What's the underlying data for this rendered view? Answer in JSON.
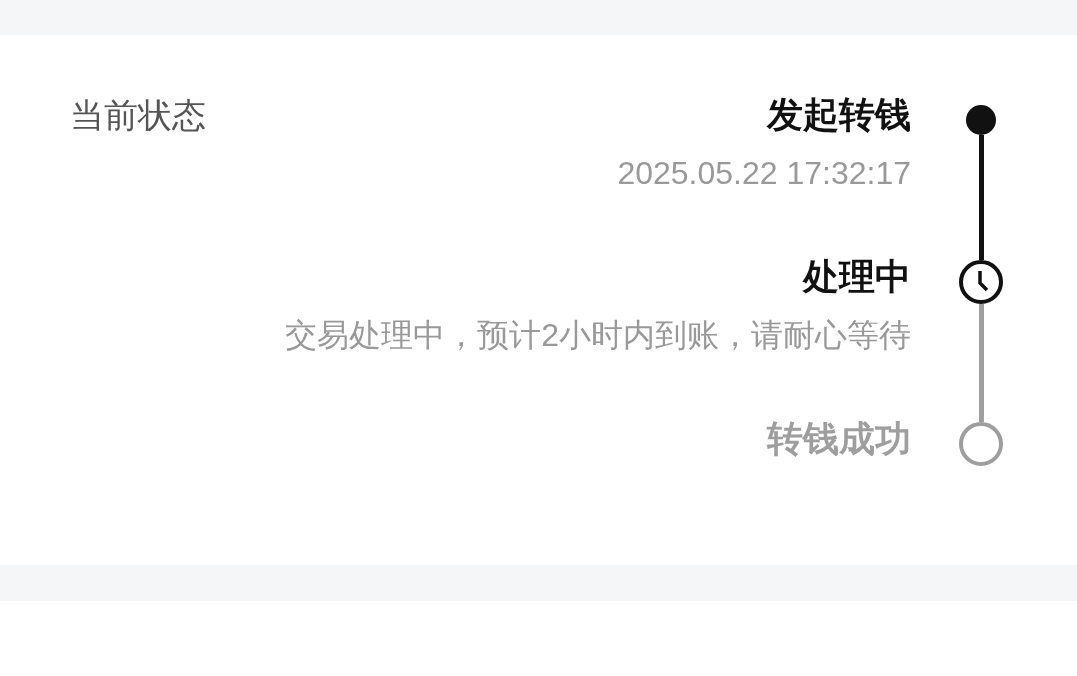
{
  "status_label": "当前状态",
  "steps": [
    {
      "kind": "done",
      "title": "发起转钱",
      "time": "2025.05.22 17:32:17"
    },
    {
      "kind": "current",
      "title": "处理中",
      "description": "交易处理中，预计2小时内到账，请耐心等待"
    },
    {
      "kind": "pending",
      "title": "转钱成功"
    }
  ]
}
